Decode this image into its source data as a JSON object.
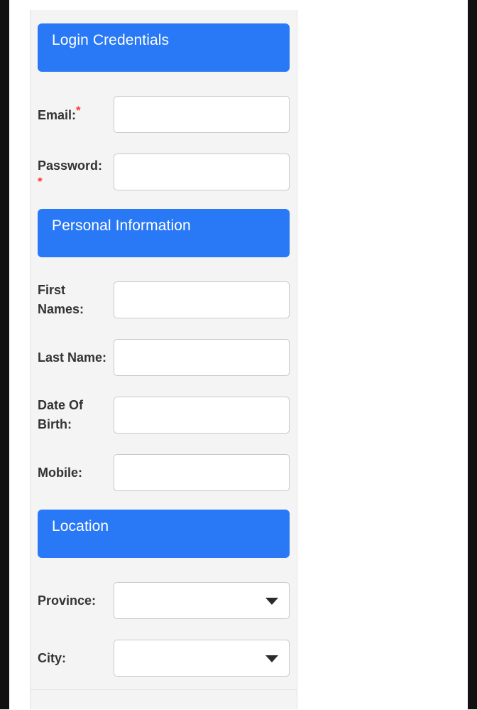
{
  "theme": {
    "accent_blue": "#2979f6",
    "panel_background": "#f4f4f4",
    "page_background": "#ffffff",
    "label_color": "#333333",
    "required_marker_color": "#ff3b30",
    "input_border_color": "#c9c9c9",
    "edge_bar_color": "#111111"
  },
  "form": {
    "sections": [
      {
        "id": "login-credentials",
        "header": "Login Credentials",
        "fields": [
          {
            "id": "email",
            "label": "Email:",
            "required_marker": "*",
            "required_wraps": false,
            "type": "text",
            "value": "",
            "placeholder": ""
          },
          {
            "id": "password",
            "label": "Password:",
            "required_marker": "*",
            "required_wraps": true,
            "type": "text",
            "value": "",
            "placeholder": ""
          }
        ]
      },
      {
        "id": "personal-information",
        "header": "Personal Information",
        "fields": [
          {
            "id": "first-names",
            "label": "First Names:",
            "required_marker": "",
            "required_wraps": false,
            "type": "text",
            "value": "",
            "placeholder": ""
          },
          {
            "id": "last-name",
            "label": "Last Name:",
            "required_marker": "",
            "required_wraps": false,
            "type": "text",
            "value": "",
            "placeholder": ""
          },
          {
            "id": "date-of-birth",
            "label": "Date Of Birth:",
            "required_marker": "",
            "required_wraps": false,
            "type": "text",
            "value": "",
            "placeholder": ""
          },
          {
            "id": "mobile",
            "label": "Mobile:",
            "required_marker": "",
            "required_wraps": false,
            "type": "text",
            "value": "",
            "placeholder": ""
          }
        ]
      },
      {
        "id": "location",
        "header": "Location",
        "fields": [
          {
            "id": "province",
            "label": "Province:",
            "required_marker": "",
            "required_wraps": false,
            "type": "select",
            "value": "",
            "placeholder": "",
            "arrow_icon": "chevron-down-icon"
          },
          {
            "id": "city",
            "label": "City:",
            "required_marker": "",
            "required_wraps": false,
            "type": "select",
            "value": "",
            "placeholder": "",
            "arrow_icon": "chevron-down-icon"
          }
        ]
      }
    ]
  }
}
